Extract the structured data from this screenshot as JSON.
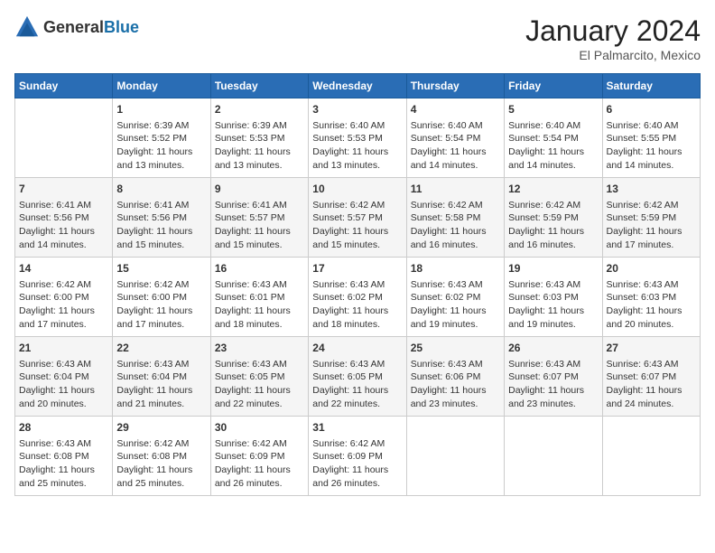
{
  "header": {
    "logo_general": "General",
    "logo_blue": "Blue",
    "month_title": "January 2024",
    "location": "El Palmarcito, Mexico"
  },
  "days_of_week": [
    "Sunday",
    "Monday",
    "Tuesday",
    "Wednesday",
    "Thursday",
    "Friday",
    "Saturday"
  ],
  "weeks": [
    [
      {
        "day": "",
        "info": ""
      },
      {
        "day": "1",
        "info": "Sunrise: 6:39 AM\nSunset: 5:52 PM\nDaylight: 11 hours\nand 13 minutes."
      },
      {
        "day": "2",
        "info": "Sunrise: 6:39 AM\nSunset: 5:53 PM\nDaylight: 11 hours\nand 13 minutes."
      },
      {
        "day": "3",
        "info": "Sunrise: 6:40 AM\nSunset: 5:53 PM\nDaylight: 11 hours\nand 13 minutes."
      },
      {
        "day": "4",
        "info": "Sunrise: 6:40 AM\nSunset: 5:54 PM\nDaylight: 11 hours\nand 14 minutes."
      },
      {
        "day": "5",
        "info": "Sunrise: 6:40 AM\nSunset: 5:54 PM\nDaylight: 11 hours\nand 14 minutes."
      },
      {
        "day": "6",
        "info": "Sunrise: 6:40 AM\nSunset: 5:55 PM\nDaylight: 11 hours\nand 14 minutes."
      }
    ],
    [
      {
        "day": "7",
        "info": "Sunrise: 6:41 AM\nSunset: 5:56 PM\nDaylight: 11 hours\nand 14 minutes."
      },
      {
        "day": "8",
        "info": "Sunrise: 6:41 AM\nSunset: 5:56 PM\nDaylight: 11 hours\nand 15 minutes."
      },
      {
        "day": "9",
        "info": "Sunrise: 6:41 AM\nSunset: 5:57 PM\nDaylight: 11 hours\nand 15 minutes."
      },
      {
        "day": "10",
        "info": "Sunrise: 6:42 AM\nSunset: 5:57 PM\nDaylight: 11 hours\nand 15 minutes."
      },
      {
        "day": "11",
        "info": "Sunrise: 6:42 AM\nSunset: 5:58 PM\nDaylight: 11 hours\nand 16 minutes."
      },
      {
        "day": "12",
        "info": "Sunrise: 6:42 AM\nSunset: 5:59 PM\nDaylight: 11 hours\nand 16 minutes."
      },
      {
        "day": "13",
        "info": "Sunrise: 6:42 AM\nSunset: 5:59 PM\nDaylight: 11 hours\nand 17 minutes."
      }
    ],
    [
      {
        "day": "14",
        "info": "Sunrise: 6:42 AM\nSunset: 6:00 PM\nDaylight: 11 hours\nand 17 minutes."
      },
      {
        "day": "15",
        "info": "Sunrise: 6:42 AM\nSunset: 6:00 PM\nDaylight: 11 hours\nand 17 minutes."
      },
      {
        "day": "16",
        "info": "Sunrise: 6:43 AM\nSunset: 6:01 PM\nDaylight: 11 hours\nand 18 minutes."
      },
      {
        "day": "17",
        "info": "Sunrise: 6:43 AM\nSunset: 6:02 PM\nDaylight: 11 hours\nand 18 minutes."
      },
      {
        "day": "18",
        "info": "Sunrise: 6:43 AM\nSunset: 6:02 PM\nDaylight: 11 hours\nand 19 minutes."
      },
      {
        "day": "19",
        "info": "Sunrise: 6:43 AM\nSunset: 6:03 PM\nDaylight: 11 hours\nand 19 minutes."
      },
      {
        "day": "20",
        "info": "Sunrise: 6:43 AM\nSunset: 6:03 PM\nDaylight: 11 hours\nand 20 minutes."
      }
    ],
    [
      {
        "day": "21",
        "info": "Sunrise: 6:43 AM\nSunset: 6:04 PM\nDaylight: 11 hours\nand 20 minutes."
      },
      {
        "day": "22",
        "info": "Sunrise: 6:43 AM\nSunset: 6:04 PM\nDaylight: 11 hours\nand 21 minutes."
      },
      {
        "day": "23",
        "info": "Sunrise: 6:43 AM\nSunset: 6:05 PM\nDaylight: 11 hours\nand 22 minutes."
      },
      {
        "day": "24",
        "info": "Sunrise: 6:43 AM\nSunset: 6:05 PM\nDaylight: 11 hours\nand 22 minutes."
      },
      {
        "day": "25",
        "info": "Sunrise: 6:43 AM\nSunset: 6:06 PM\nDaylight: 11 hours\nand 23 minutes."
      },
      {
        "day": "26",
        "info": "Sunrise: 6:43 AM\nSunset: 6:07 PM\nDaylight: 11 hours\nand 23 minutes."
      },
      {
        "day": "27",
        "info": "Sunrise: 6:43 AM\nSunset: 6:07 PM\nDaylight: 11 hours\nand 24 minutes."
      }
    ],
    [
      {
        "day": "28",
        "info": "Sunrise: 6:43 AM\nSunset: 6:08 PM\nDaylight: 11 hours\nand 25 minutes."
      },
      {
        "day": "29",
        "info": "Sunrise: 6:42 AM\nSunset: 6:08 PM\nDaylight: 11 hours\nand 25 minutes."
      },
      {
        "day": "30",
        "info": "Sunrise: 6:42 AM\nSunset: 6:09 PM\nDaylight: 11 hours\nand 26 minutes."
      },
      {
        "day": "31",
        "info": "Sunrise: 6:42 AM\nSunset: 6:09 PM\nDaylight: 11 hours\nand 26 minutes."
      },
      {
        "day": "",
        "info": ""
      },
      {
        "day": "",
        "info": ""
      },
      {
        "day": "",
        "info": ""
      }
    ]
  ]
}
